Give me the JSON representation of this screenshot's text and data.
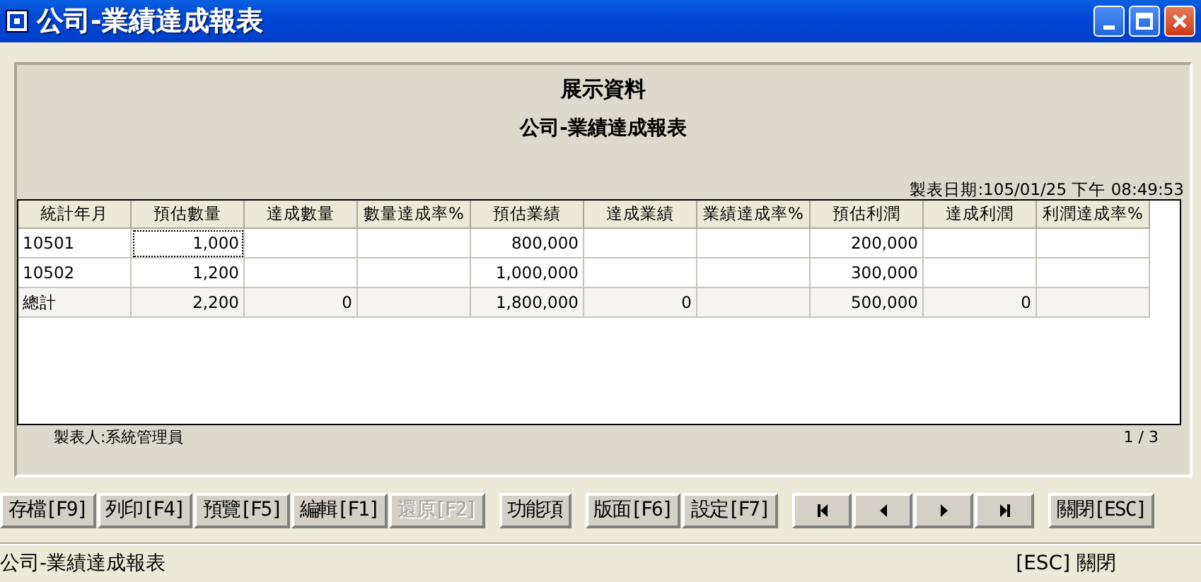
{
  "window": {
    "title": "公司-業績達成報表"
  },
  "report": {
    "company": "展示資料",
    "title": "公司-業績達成報表",
    "date": "製表日期:105/01/25 下午 08:49:53",
    "maker": "製表人:系統管理員",
    "page": "1 / 3"
  },
  "table": {
    "columns": [
      "統計年月",
      "預估數量",
      "達成數量",
      "數量達成率%",
      "預估業績",
      "達成業績",
      "業績達成率%",
      "預估利潤",
      "達成利潤",
      "利潤達成率%"
    ],
    "rows": [
      {
        "kind": "data",
        "cells": [
          {
            "text": "10501",
            "focused": false
          },
          {
            "text": "1,000",
            "focused": true
          },
          {
            "focused": false
          },
          {
            "focused": false
          },
          {
            "text": "800,000",
            "focused": false
          },
          {
            "focused": false
          },
          {
            "focused": false
          },
          {
            "text": "200,000",
            "focused": false
          },
          {
            "focused": false
          },
          {
            "focused": false
          }
        ]
      },
      {
        "kind": "data",
        "cells": [
          {
            "text": "10502",
            "focused": false
          },
          {
            "text": "1,200",
            "focused": false
          },
          {
            "focused": false
          },
          {
            "focused": false
          },
          {
            "text": "1,000,000",
            "focused": false
          },
          {
            "focused": false
          },
          {
            "focused": false
          },
          {
            "text": "300,000",
            "focused": false
          },
          {
            "focused": false
          },
          {
            "focused": false
          }
        ]
      },
      {
        "kind": "total",
        "cells": [
          {
            "text": "總計",
            "focused": false
          },
          {
            "text": "2,200",
            "focused": false
          },
          {
            "text": "0",
            "focused": false
          },
          {
            "focused": false
          },
          {
            "text": "1,800,000",
            "focused": false
          },
          {
            "text": "0",
            "focused": false
          },
          {
            "focused": false
          },
          {
            "text": "500,000",
            "focused": false
          },
          {
            "text": "0",
            "focused": false
          },
          {
            "focused": false
          }
        ]
      }
    ]
  },
  "toolbar": {
    "groups": [
      [
        {
          "kind": "text",
          "label": "存檔[F9]",
          "disabled": false
        },
        {
          "kind": "text",
          "label": "列印[F4]",
          "disabled": false
        },
        {
          "kind": "text",
          "label": "預覽[F5]",
          "disabled": false
        },
        {
          "kind": "text",
          "label": "編輯[F1]",
          "disabled": false
        },
        {
          "kind": "text",
          "label": "還原[F2]",
          "disabled": true
        }
      ],
      [
        {
          "kind": "text",
          "label": "功能項",
          "disabled": false
        }
      ],
      [
        {
          "kind": "text",
          "label": "版面[F6]",
          "disabled": false
        },
        {
          "kind": "text",
          "label": "設定[F7]",
          "disabled": false
        }
      ],
      [
        {
          "kind": "first",
          "disabled": false
        },
        {
          "kind": "prev",
          "disabled": false
        },
        {
          "kind": "next",
          "disabled": false
        },
        {
          "kind": "last",
          "disabled": false
        }
      ],
      [
        {
          "kind": "text",
          "label": "關閉[ESC]",
          "disabled": false
        }
      ]
    ]
  },
  "status_bar": {
    "left": "公司-業績達成報表",
    "right": "[ESC] 關閉"
  }
}
